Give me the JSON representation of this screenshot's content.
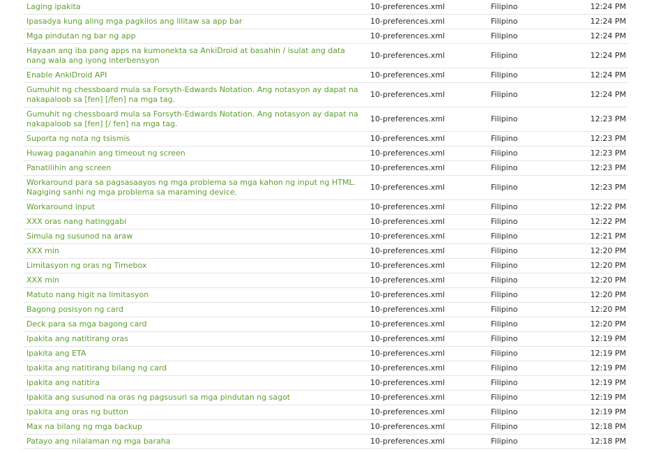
{
  "rows": [
    {
      "text": "Laging ipakita",
      "file": "10-preferences.xml",
      "lang": "Filipino",
      "time": "12:24 PM"
    },
    {
      "text": "Ipasadya kung aling mga pagkilos ang lilitaw sa app bar",
      "file": "10-preferences.xml",
      "lang": "Filipino",
      "time": "12:24 PM"
    },
    {
      "text": "Mga pindutan ng bar ng app",
      "file": "10-preferences.xml",
      "lang": "Filipino",
      "time": "12:24 PM"
    },
    {
      "text": "Hayaan ang iba pang apps na kumonekta sa AnkiDroid at basahin / isulat ang data nang wala ang iyong interbensyon",
      "file": "10-preferences.xml",
      "lang": "Filipino",
      "time": "12:24 PM",
      "two": true
    },
    {
      "text": "Enable AnkiDroid API",
      "file": "10-preferences.xml",
      "lang": "Filipino",
      "time": "12:24 PM"
    },
    {
      "text": "Gumuhit ng chessboard mula sa Forsyth-Edwards Notation. Ang notasyon ay dapat na nakapaloob sa [fen] [/fen] na mga tag.",
      "file": "10-preferences.xml",
      "lang": "Filipino",
      "time": "12:24 PM",
      "two": true
    },
    {
      "text": "Gumuhit ng chessboard mula sa Forsyth-Edwards Notation. Ang notasyon ay dapat na nakapaloob sa [fen] [/ fen] na mga tag.",
      "file": "10-preferences.xml",
      "lang": "Filipino",
      "time": "12:23 PM",
      "two": true
    },
    {
      "text": "Suporta ng nota ng tsismis",
      "file": "10-preferences.xml",
      "lang": "Filipino",
      "time": "12:23 PM"
    },
    {
      "text": "Huwag paganahin ang timeout ng screen",
      "file": "10-preferences.xml",
      "lang": "Filipino",
      "time": "12:23 PM"
    },
    {
      "text": "Panatilihin ang screen",
      "file": "10-preferences.xml",
      "lang": "Filipino",
      "time": "12:23 PM"
    },
    {
      "text": "Workaround para sa pagsasaayos ng mga problema sa mga kahon ng input ng HTML. Nagiging sanhi ng mga problema sa maraming device.",
      "file": "10-preferences.xml",
      "lang": "Filipino",
      "time": "12:23 PM",
      "two": true
    },
    {
      "text": "Workaround input",
      "file": "10-preferences.xml",
      "lang": "Filipino",
      "time": "12:22 PM"
    },
    {
      "text": "XXX oras nang hatinggabi",
      "file": "10-preferences.xml",
      "lang": "Filipino",
      "time": "12:22 PM"
    },
    {
      "text": "Simula ng susunod na araw",
      "file": "10-preferences.xml",
      "lang": "Filipino",
      "time": "12:21 PM"
    },
    {
      "text": "XXX min",
      "file": "10-preferences.xml",
      "lang": "Filipino",
      "time": "12:20 PM"
    },
    {
      "text": "Limitasyon ng oras ng Timebox",
      "file": "10-preferences.xml",
      "lang": "Filipino",
      "time": "12:20 PM"
    },
    {
      "text": "XXX min",
      "file": "10-preferences.xml",
      "lang": "Filipino",
      "time": "12:20 PM"
    },
    {
      "text": "Matuto nang higit na limitasyon",
      "file": "10-preferences.xml",
      "lang": "Filipino",
      "time": "12:20 PM"
    },
    {
      "text": "Bagong posisyon ng card",
      "file": "10-preferences.xml",
      "lang": "Filipino",
      "time": "12:20 PM"
    },
    {
      "text": "Deck para sa mga bagong card",
      "file": "10-preferences.xml",
      "lang": "Filipino",
      "time": "12:20 PM"
    },
    {
      "text": "Ipakita ang natitirang oras",
      "file": "10-preferences.xml",
      "lang": "Filipino",
      "time": "12:19 PM"
    },
    {
      "text": "Ipakita ang ETA",
      "file": "10-preferences.xml",
      "lang": "Filipino",
      "time": "12:19 PM"
    },
    {
      "text": "Ipakita ang natitirang bilang ng card",
      "file": "10-preferences.xml",
      "lang": "Filipino",
      "time": "12:19 PM"
    },
    {
      "text": "Ipakita ang natitira",
      "file": "10-preferences.xml",
      "lang": "Filipino",
      "time": "12:19 PM"
    },
    {
      "text": "Ipakita ang susunod na oras ng pagsusuri sa mga pindutan ng sagot",
      "file": "10-preferences.xml",
      "lang": "Filipino",
      "time": "12:19 PM"
    },
    {
      "text": "Ipakita ang oras ng button",
      "file": "10-preferences.xml",
      "lang": "Filipino",
      "time": "12:19 PM"
    },
    {
      "text": "Max na bilang ng mga backup",
      "file": "10-preferences.xml",
      "lang": "Filipino",
      "time": "12:18 PM"
    },
    {
      "text": "Patayo ang nilalaman ng mga baraha",
      "file": "10-preferences.xml",
      "lang": "Filipino",
      "time": "12:18 PM"
    }
  ]
}
